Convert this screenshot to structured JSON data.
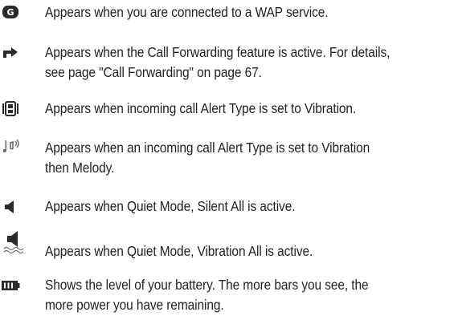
{
  "entries": [
    {
      "icon": "wap-service-icon",
      "lines": [
        "Appears when you are connected to a WAP service."
      ]
    },
    {
      "icon": "call-forwarding-icon",
      "lines": [
        "Appears when the Call Forwarding feature is active. For details,",
        "see page \"Call Forwarding\" on page 67."
      ]
    },
    {
      "icon": "vibration-icon",
      "lines": [
        "Appears when incoming call Alert Type is set to Vibration."
      ]
    },
    {
      "icon": "vibration-then-melody-icon",
      "lines": [
        "Appears when an incoming call Alert Type is set to Vibration",
        "then Melody."
      ]
    },
    {
      "icon": "silent-all-icon",
      "lines": [
        "Appears when Quiet Mode, Silent All is active."
      ]
    },
    {
      "icon": "vibration-all-icon",
      "lines": [
        "Appears when Quiet Mode, Vibration All is active."
      ]
    },
    {
      "icon": "battery-level-icon",
      "lines": [
        "Shows the level of your battery. The more bars you see, the",
        "more power you have remaining."
      ]
    }
  ]
}
